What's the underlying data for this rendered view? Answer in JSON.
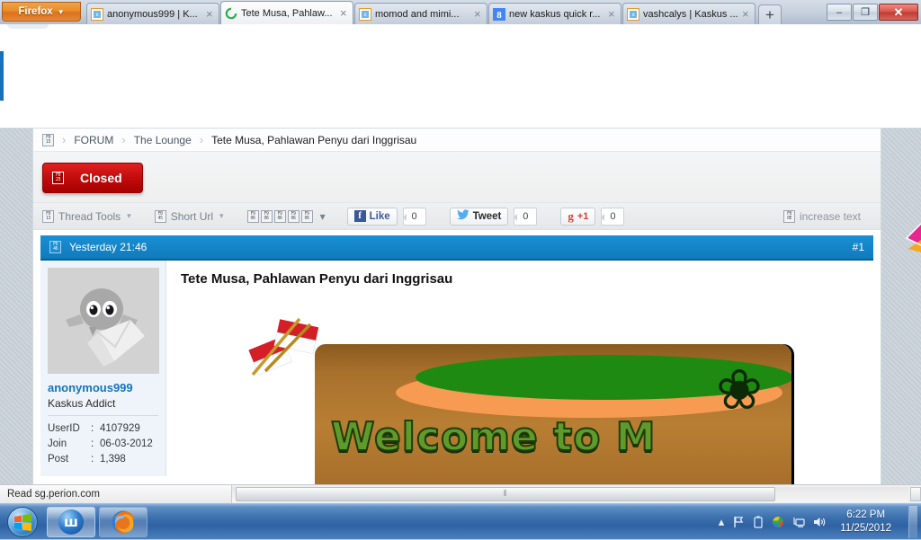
{
  "browser": {
    "app_button": "Firefox",
    "app_button_caret": "▼",
    "new_tab_label": "+",
    "tabs": [
      {
        "label": "anonymous999 | K...",
        "favicon": "broken-image-icon",
        "active": false,
        "close": "×"
      },
      {
        "label": "Tete Musa, Pahlaw...",
        "favicon": "loading-spinner-icon",
        "active": true,
        "close": "×"
      },
      {
        "label": "momod and mimi...",
        "favicon": "broken-image-icon",
        "active": false,
        "close": "×"
      },
      {
        "label": "new kaskus quick r...",
        "favicon": "google-icon",
        "active": false,
        "close": "×"
      },
      {
        "label": "vashcalys | Kaskus ...",
        "favicon": "broken-image-icon",
        "active": false,
        "close": "×"
      }
    ],
    "window_controls": {
      "minimize": "–",
      "maximize": "❐",
      "close": "✕"
    }
  },
  "page": {
    "breadcrumb": {
      "icon": "broken-image-icon",
      "items": [
        "FORUM",
        "The Lounge",
        "Tete Musa, Pahlawan Penyu dari Inggrisau"
      ],
      "separator": "›"
    },
    "closed_button": {
      "label": "Closed",
      "icon": "broken-image-icon"
    },
    "toolbar": {
      "thread_tools": "Thread Tools",
      "short_url": "Short Url",
      "dropdown_caret": "▾",
      "rating_stars": 5,
      "increase_text": "increase text",
      "increase_text_icon": "broken-image-icon"
    },
    "social": [
      {
        "name": "facebook-like",
        "glyph": "f",
        "label": "Like",
        "count": "0"
      },
      {
        "name": "twitter-tweet",
        "glyph": "🐦",
        "label": "Tweet",
        "count": "0"
      },
      {
        "name": "google-plus-one",
        "glyph": "g",
        "label": "+1",
        "count": "0"
      }
    ],
    "post": {
      "header": {
        "icon": "broken-image-icon",
        "timestamp": "Yesterday 21:46",
        "number": "#1"
      },
      "user": {
        "avatar": "default-avatar-image",
        "username": "anonymous999",
        "title": "Kaskus Addict",
        "stats": [
          {
            "key": "UserID",
            "colon": ":",
            "value": "4107929"
          },
          {
            "key": "Join",
            "colon": ":",
            "value": "06-03-2012"
          },
          {
            "key": "Post",
            "colon": ":",
            "value": "1,398"
          }
        ]
      },
      "title": "Tete Musa, Pahlawan Penyu dari Inggrisau",
      "banner": {
        "alt": "welcome-banner-image",
        "text": "Welcome to M",
        "flags": "indonesia-flags-image",
        "deco": "❀"
      }
    }
  },
  "statusbar": {
    "text": "Read sg.perion.com",
    "scroll_grip": "⫴"
  },
  "taskbar": {
    "start": "windows-start-orb",
    "items": [
      {
        "name": "taskbar-item-w-app",
        "glyph": "ш",
        "active": true
      },
      {
        "name": "taskbar-item-firefox",
        "glyph": "firefox-icon",
        "active": false
      }
    ],
    "tray": [
      {
        "name": "show-hidden-icons",
        "glyph": "▴"
      },
      {
        "name": "action-center-flag-icon",
        "glyph": "⚑"
      },
      {
        "name": "battery-icon",
        "glyph": "▯"
      },
      {
        "name": "update-globe-icon",
        "glyph": "◉"
      },
      {
        "name": "network-icon",
        "glyph": "⌸"
      },
      {
        "name": "volume-icon",
        "glyph": "🔊"
      }
    ],
    "clock_time": "6:22 PM",
    "clock_date": "11/25/2012"
  },
  "colors": {
    "accent_blue": "#0f7bbd",
    "closed_red": "#c10c0c",
    "link_blue": "#1273c0",
    "taskbar_blue": "#3c70ae"
  }
}
